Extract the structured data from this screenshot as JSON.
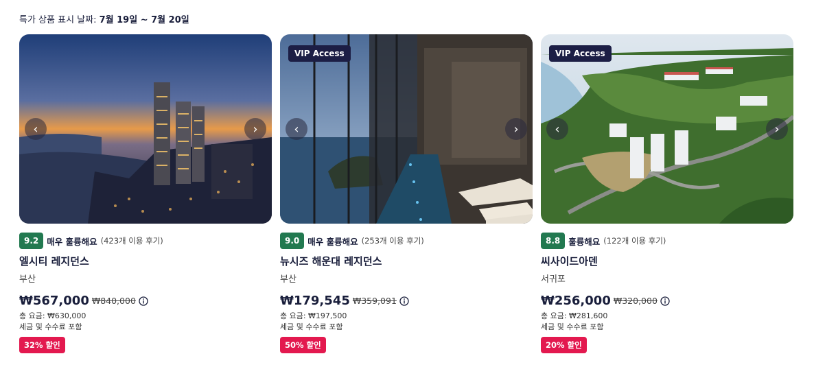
{
  "header": {
    "prefix": "특가 상품 표시 날짜: ",
    "dates": "7월 19일 ~ 7월 20일"
  },
  "icons": {
    "prev": "chevron-left-icon",
    "next": "chevron-right-icon",
    "info": "info-icon"
  },
  "colors": {
    "score_bg": "#227950",
    "deal_bg": "#e3194f",
    "vip_bg": "#1c1e45"
  },
  "cards": [
    {
      "vip": "",
      "score": "9.2",
      "rating_label": "매우 훌륭해요",
      "reviews": "(423개 이용 후기)",
      "name": "엘시티 레지던스",
      "location": "부산",
      "price": "₩567,000",
      "old_price": "₩840,000",
      "total": "총 요금: ₩630,000",
      "tax": "세금 및 수수료 포함",
      "discount": "32% 할인"
    },
    {
      "vip": "VIP Access",
      "score": "9.0",
      "rating_label": "매우 훌륭해요",
      "reviews": "(253개 이용 후기)",
      "name": "뉴시즈 해운대 레지던스",
      "location": "부산",
      "price": "₩179,545",
      "old_price": "₩359,091",
      "total": "총 요금: ₩197,500",
      "tax": "세금 및 수수료 포함",
      "discount": "50% 할인"
    },
    {
      "vip": "VIP Access",
      "score": "8.8",
      "rating_label": "훌륭해요",
      "reviews": "(122개 이용 후기)",
      "name": "씨사이드아덴",
      "location": "서귀포",
      "price": "₩256,000",
      "old_price": "₩320,000",
      "total": "총 요금: ₩281,600",
      "tax": "세금 및 수수료 포함",
      "discount": "20% 할인"
    }
  ]
}
